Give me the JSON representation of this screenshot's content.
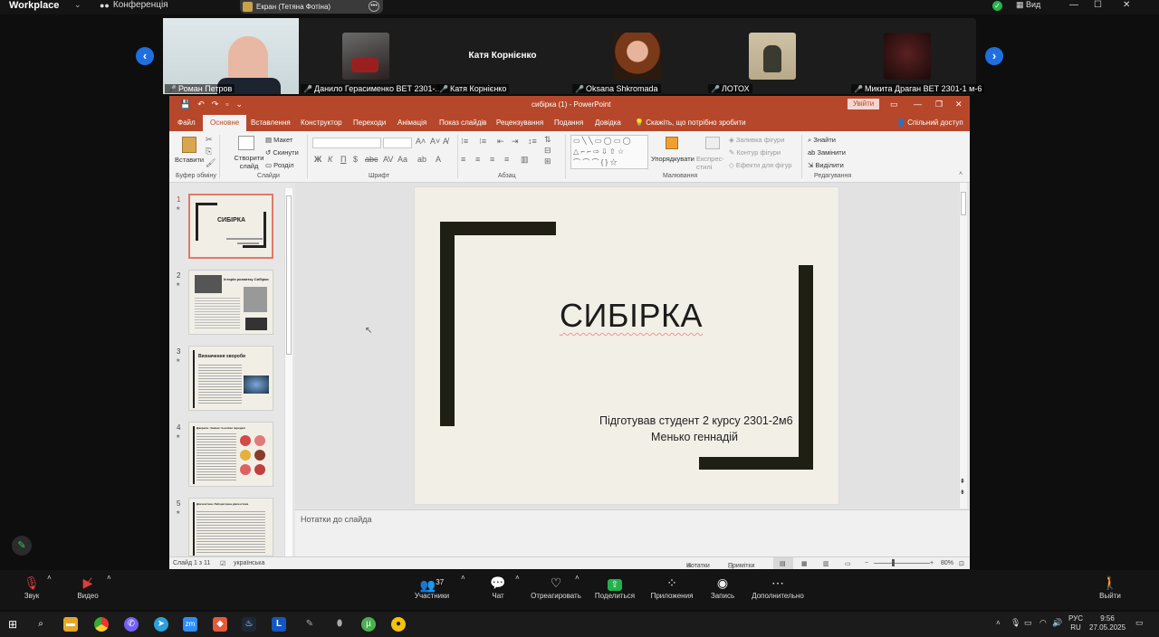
{
  "zoom": {
    "app_name": "Workplace",
    "conference_label": "Конференція",
    "screen_share_label": "Екран (Тетяна Фотіна)",
    "view_label": "Вид",
    "participants": [
      {
        "name": "Роман Петров",
        "muted": true
      },
      {
        "name": "Данило Герасименко ВЕТ 2301-...",
        "muted": true
      },
      {
        "name": "Катя Корнієнко",
        "muted": true,
        "display_name_center": "Катя Корнієнко"
      },
      {
        "name": "Oksana Shkromada",
        "muted": true
      },
      {
        "name": "ЛОТОХ",
        "muted": true
      },
      {
        "name": "Микита Драган ВЕТ 2301-1 м-6",
        "muted": true
      }
    ],
    "controls": {
      "audio": "Звук",
      "video": "Видео",
      "participants": "Участники",
      "participants_count": "37",
      "chat": "Чат",
      "react": "Отреагировать",
      "share": "Поделиться",
      "apps": "Приложения",
      "record": "Запись",
      "more": "Дополнительно",
      "leave": "Выйти"
    }
  },
  "powerpoint": {
    "title": "сибірка (1)  -  PowerPoint",
    "login_button": "Увійти",
    "tabs": [
      "Файл",
      "Основне",
      "Вставлення",
      "Конструктор",
      "Переходи",
      "Анімація",
      "Показ слайдів",
      "Рецензування",
      "Подання",
      "Довідка"
    ],
    "active_tab": "Основне",
    "tell_me": "Скажіть, що потрібно зробити",
    "share": "Спільний доступ",
    "ribbon": {
      "paste": "Вставити",
      "new_slide": "Створити слайд",
      "layout": "Макет",
      "reset": "Скинути",
      "section": "Розділ",
      "arrange": "Упорядкувати",
      "quick_styles": "Експрес-стилі",
      "shape_fill": "Заливка фігури",
      "shape_outline": "Контур фігури",
      "shape_effects": "Ефекти для фігур",
      "find": "Знайти",
      "replace": "Замінити",
      "select": "Виділити",
      "groups": {
        "clipboard": "Буфер обміну",
        "slides": "Слайди",
        "font": "Шрифт",
        "paragraph": "Абзац",
        "drawing": "Малювання",
        "editing": "Редагування"
      }
    },
    "slide_numbers": [
      "1",
      "2",
      "3",
      "4",
      "5"
    ],
    "thumb_texts": {
      "t1_title": "СИБІРКА",
      "t2_title": "Історія розвитку Сибірки",
      "t3_title": "Визначення хвороби",
      "t4_title": "Джерела. Чинник та шляхи передачі",
      "t5_title": "Діагностика. Лабораторна діагностика"
    },
    "slide": {
      "title": "СИБІРКА",
      "subtitle_line1": "Підготував студент 2 курсу 2301-2м6",
      "subtitle_line2": "Менько геннадій"
    },
    "notes_placeholder": "Нотатки до слайда",
    "status": {
      "slide_of": "Слайд 1 з 11",
      "language": "українська",
      "notes": "Нотатки",
      "comments": "Примітки",
      "zoom": "80%"
    }
  },
  "taskbar": {
    "lang_top": "РУС",
    "lang_bottom": "RU",
    "time": "9:56",
    "date": "27.05.2025"
  },
  "colors": {
    "ppt_accent": "#b7472a",
    "zoom_blue": "#1f6fe0",
    "slide_bg": "#f2efe6",
    "slide_frame": "#1f1f14"
  }
}
